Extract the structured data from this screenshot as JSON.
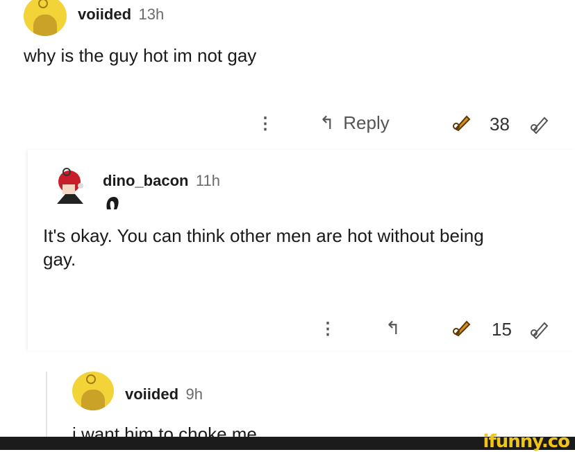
{
  "comments": [
    {
      "username": "voiided",
      "time": "13h",
      "text": "why is the guy hot im not gay",
      "reply_label": "Reply",
      "votes": "38"
    },
    {
      "username": "dino_bacon",
      "time": "11h",
      "flair_icon": "hair-emoji-icon",
      "text_line1": "It's okay. You can think other men are hot without being",
      "text_line2": "gay.",
      "votes": "15"
    },
    {
      "username": "voiided",
      "time": "9h",
      "text": "i want him to choke me"
    }
  ],
  "watermark": "ifunny.co",
  "colors": {
    "avatar_yellow": "#f2d338",
    "upvote_orange": "#d98d1a",
    "watermark_yellow": "#f0c419"
  }
}
